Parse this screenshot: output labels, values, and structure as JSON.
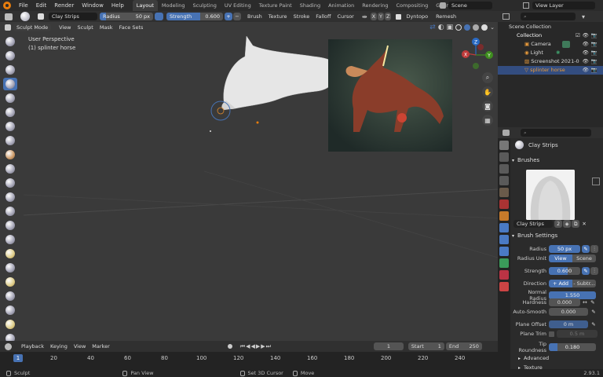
{
  "menu": [
    "File",
    "Edit",
    "Render",
    "Window",
    "Help"
  ],
  "workspaces": [
    "Layout",
    "Modeling",
    "Sculpting",
    "UV Editing",
    "Texture Paint",
    "Shading",
    "Animation",
    "Rendering",
    "Compositing",
    "Geometry Nodes"
  ],
  "active_workspace": "Layout",
  "scene": "Scene",
  "view_layer": "View Layer",
  "toolhdr": {
    "brush": "Clay Strips",
    "radius_label": "Radius",
    "radius_value": "50 px",
    "strength_label": "Strength",
    "strength_value": "0.600",
    "strength_fraction": 0.6,
    "menus": [
      "Brush",
      "Texture",
      "Stroke",
      "Falloff",
      "Cursor"
    ],
    "axes": [
      "X",
      "Y",
      "Z"
    ],
    "dyntopo": "Dyntopo",
    "remesh": "Remesh"
  },
  "modehdr": {
    "mode": "Sculpt Mode",
    "menus": [
      "View",
      "Sculpt",
      "Mask",
      "Face Sets"
    ]
  },
  "viewport": {
    "perspective": "User Perspective",
    "object": "(1) splinter horse",
    "gizmo": {
      "x": "X",
      "y": "Y",
      "z": "Z"
    }
  },
  "timeline": {
    "menus": [
      "Playback",
      "Keying",
      "View",
      "Marker"
    ],
    "current_frame": "1",
    "start_label": "Start",
    "start": "1",
    "end_label": "End",
    "end": "250",
    "ticks": [
      "1",
      "20",
      "40",
      "60",
      "80",
      "100",
      "120",
      "140",
      "160",
      "180",
      "200",
      "220",
      "240"
    ]
  },
  "status": {
    "items": [
      "Sculpt",
      "Pan View",
      "Set 3D Cursor",
      "Move"
    ],
    "version": "2.93.1"
  },
  "outliner": {
    "rows": [
      {
        "label": "Scene Collection",
        "indent": 0
      },
      {
        "label": "Collection",
        "indent": 1
      },
      {
        "label": "Camera",
        "indent": 2
      },
      {
        "label": "Light",
        "indent": 2
      },
      {
        "label": "Screenshot 2021-0",
        "indent": 2
      },
      {
        "label": "splinter horse",
        "indent": 2,
        "selected": true
      }
    ]
  },
  "props": {
    "tool_name": "Clay Strips",
    "brushes_header": "Brushes",
    "brush_field": "Clay Strips",
    "brush_users": "2",
    "brush_settings_header": "Brush Settings",
    "rows": [
      {
        "label": "Radius",
        "value": "50 px"
      },
      {
        "label": "Radius Unit",
        "opt1": "View",
        "opt2": "Scene"
      },
      {
        "label": "Strength",
        "value": "0.600"
      },
      {
        "label": "Direction",
        "opt1": "+ Add",
        "opt2": "- Subtr..."
      },
      {
        "label": "Normal Radius",
        "value": "1.550"
      },
      {
        "label": "Hardness",
        "value": "0.000"
      },
      {
        "label": "Auto-Smooth",
        "value": "0.000"
      },
      {
        "label": "Plane Offset",
        "value": "0 m"
      },
      {
        "label": "Plane Trim",
        "value": "0.5 m"
      },
      {
        "label": "Tip Roundness",
        "value": "0.180"
      }
    ],
    "advanced": "Advanced",
    "texture": "Texture"
  }
}
